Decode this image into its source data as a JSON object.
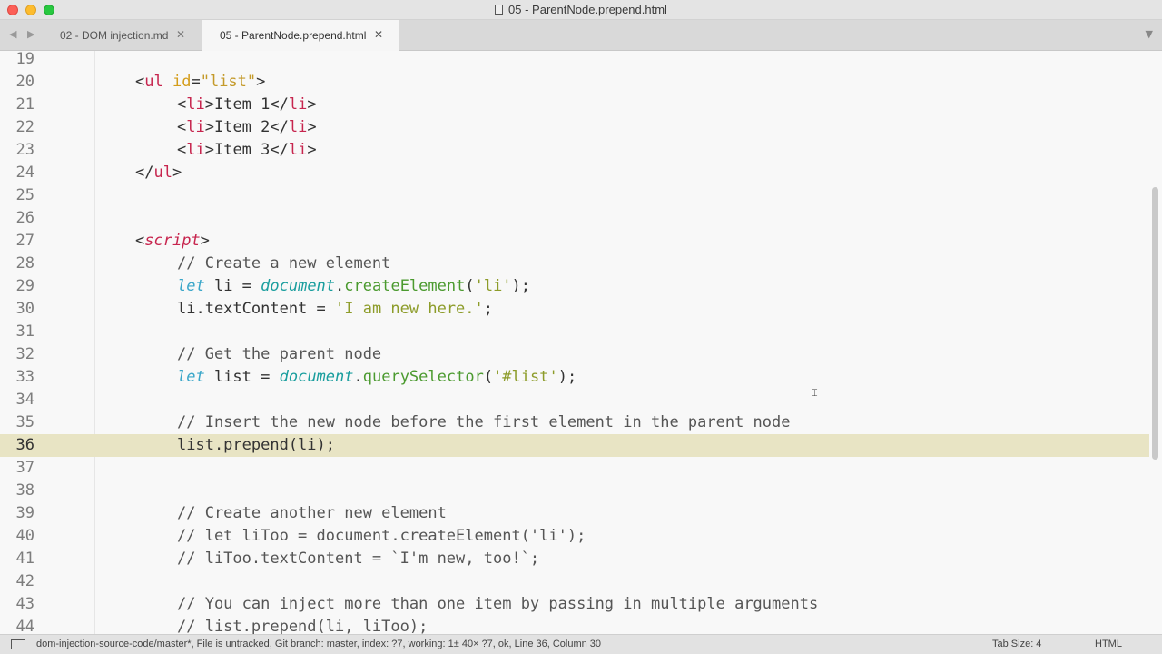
{
  "window": {
    "title": "05 - ParentNode.prepend.html"
  },
  "tabs": [
    {
      "label": "02 - DOM injection.md",
      "close": "✕"
    },
    {
      "label": "05 - ParentNode.prepend.html",
      "close": "✕"
    }
  ],
  "nav": {
    "arrows": "◀ ▶",
    "menu": "▼"
  },
  "editor": {
    "line_numbers": [
      "19",
      "20",
      "21",
      "22",
      "23",
      "24",
      "25",
      "26",
      "27",
      "28",
      "29",
      "30",
      "31",
      "32",
      "33",
      "34",
      "35",
      "36",
      "37",
      "38",
      "39",
      "40",
      "41",
      "42",
      "43",
      "44"
    ],
    "current_line": "36",
    "code": {
      "l20": [
        "<",
        "ul",
        " ",
        "id",
        "=",
        "\"list\"",
        ">"
      ],
      "l21": [
        "<",
        "li",
        ">Item 1</",
        "li",
        ">"
      ],
      "l22": [
        "<",
        "li",
        ">Item 2</",
        "li",
        ">"
      ],
      "l23": [
        "<",
        "li",
        ">Item 3</",
        "li",
        ">"
      ],
      "l24": [
        "</",
        "ul",
        ">"
      ],
      "l27": [
        "<",
        "script",
        ">"
      ],
      "l28": "// Create a new element",
      "l29": [
        "let",
        " li = ",
        "document",
        ".",
        "createElement",
        "(",
        "'li'",
        ");"
      ],
      "l30": [
        "li.textContent = ",
        "'I am new here.'",
        ";"
      ],
      "l32": "// Get the parent node",
      "l33": [
        "let",
        " list = ",
        "document",
        ".",
        "querySelector",
        "(",
        "'#list'",
        ");"
      ],
      "l35": "// Insert the new node before the first element in the parent node",
      "l36": "list.prepend(li);",
      "l39": "// Create another new element",
      "l40": "// let liToo = document.createElement('li');",
      "l41": "// liToo.textContent = `I'm new, too!`;",
      "l43": "// You can inject more than one item by passing in multiple arguments",
      "l44": "// list.prepend(li, liToo);"
    }
  },
  "status": {
    "text": "dom-injection-source-code/master*, File is untracked, Git branch: master, index: ?7, working: 1± 40× ?7, ok, Line 36, Column 30",
    "tab_size": "Tab Size: 4",
    "syntax": "HTML"
  }
}
